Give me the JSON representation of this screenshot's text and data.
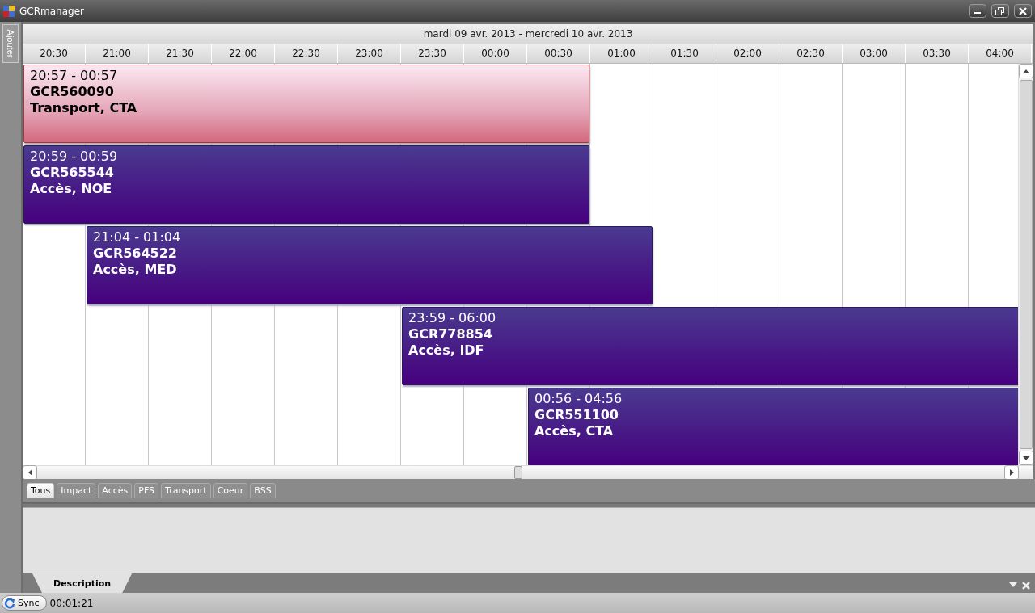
{
  "window": {
    "title": "GCRmanager"
  },
  "side_tab": {
    "label": "Ajouter"
  },
  "schedule": {
    "date_range": "mardi 09 avr. 2013 - mercredi 10 avr. 2013",
    "times": [
      "20:30",
      "21:00",
      "21:30",
      "22:00",
      "22:30",
      "23:00",
      "23:30",
      "00:00",
      "00:30",
      "01:00",
      "01:30",
      "02:00",
      "02:30",
      "03:00",
      "03:30",
      "04:00"
    ],
    "events": [
      {
        "kind": "transport",
        "time": "20:57 - 00:57",
        "id": "GCR560090",
        "category": "Transport, CTA"
      },
      {
        "kind": "acces",
        "time": "20:59 - 00:59",
        "id": "GCR565544",
        "category": "Accès, NOE"
      },
      {
        "kind": "acces",
        "time": "21:04 - 01:04",
        "id": "GCR564522",
        "category": "Accès, MED"
      },
      {
        "kind": "acces",
        "time": "23:59 - 06:00",
        "id": "GCR778854",
        "category": "Accès, IDF"
      },
      {
        "kind": "acces",
        "time": "00:56 - 04:56",
        "id": "GCR551100",
        "category": "Accès, CTA"
      }
    ]
  },
  "filter_tabs": [
    {
      "label": "Tous",
      "selected": true
    },
    {
      "label": "Impact",
      "selected": false
    },
    {
      "label": "Accès",
      "selected": false
    },
    {
      "label": "PFS",
      "selected": false
    },
    {
      "label": "Transport",
      "selected": false
    },
    {
      "label": "Coeur",
      "selected": false
    },
    {
      "label": "BSS",
      "selected": false
    }
  ],
  "description_panel": {
    "tab": "Description"
  },
  "status_bar": {
    "sync_button": "Sync",
    "elapsed": "00:01:21"
  }
}
